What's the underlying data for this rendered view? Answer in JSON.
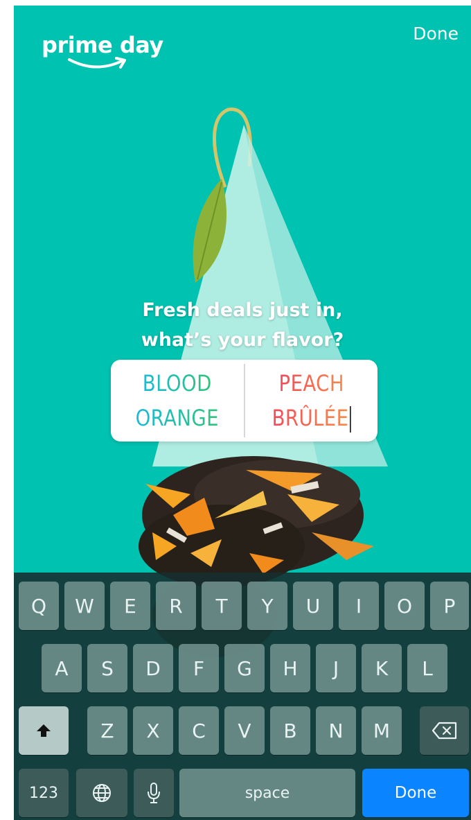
{
  "header": {
    "brand": "prime day",
    "done_label": "Done"
  },
  "poll": {
    "question_line1": "Fresh deals just in,",
    "question_line2": "what’s your flavor?",
    "option_left_line1": "BLOOD",
    "option_left_line2": "ORANGE",
    "option_right_line1": "PEACH",
    "option_right_line2": "BRÛLÉE"
  },
  "keyboard": {
    "row1": [
      "Q",
      "W",
      "E",
      "R",
      "T",
      "Y",
      "U",
      "I",
      "O",
      "P"
    ],
    "row2": [
      "A",
      "S",
      "D",
      "F",
      "G",
      "H",
      "J",
      "K",
      "L"
    ],
    "row3": [
      "Z",
      "X",
      "C",
      "V",
      "B",
      "N",
      "M"
    ],
    "numbers_label": "123",
    "space_label": "space",
    "done_label": "Done",
    "shift_icon": "shift-icon",
    "backspace_icon": "backspace-icon",
    "globe_icon": "globe-icon",
    "mic_icon": "microphone-icon"
  },
  "colors": {
    "background": "#00c2b0",
    "done_key": "#0a84ff"
  }
}
